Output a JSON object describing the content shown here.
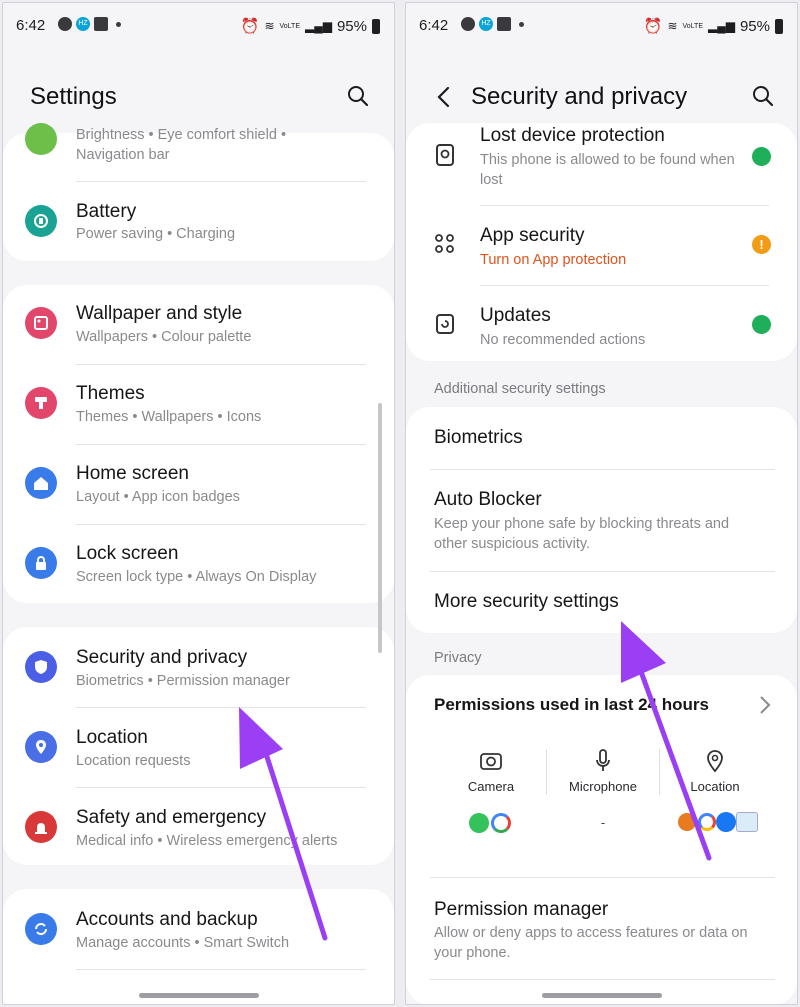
{
  "status": {
    "time": "6:42",
    "battery": "95%",
    "hz_badge": "HZ",
    "volte": "VoLTE"
  },
  "left": {
    "title": "Settings",
    "partial": {
      "sub_line1": "Brightness  •  Eye comfort shield  •",
      "sub_line2": "Navigation bar"
    },
    "items": [
      {
        "title": "Battery",
        "sub": "Power saving  •  Charging",
        "icon": "battery-icon",
        "color": "#1aa394"
      },
      {
        "title": "Wallpaper and style",
        "sub": "Wallpapers  •  Colour palette",
        "icon": "wallpaper-icon",
        "color": "#e2466b"
      },
      {
        "title": "Themes",
        "sub": "Themes  •  Wallpapers  •  Icons",
        "icon": "themes-icon",
        "color": "#e2466b"
      },
      {
        "title": "Home screen",
        "sub": "Layout  •  App icon badges",
        "icon": "home-icon",
        "color": "#3a7bea"
      },
      {
        "title": "Lock screen",
        "sub": "Screen lock type  •  Always On Display",
        "icon": "lock-icon",
        "color": "#3a7bea"
      },
      {
        "title": "Security and privacy",
        "sub": "Biometrics  •  Permission manager",
        "icon": "shield-icon",
        "color": "#4a5fe6"
      },
      {
        "title": "Location",
        "sub": "Location requests",
        "icon": "location-pin-icon",
        "color": "#4a6ee6"
      },
      {
        "title": "Safety and emergency",
        "sub": "Medical info  •  Wireless emergency alerts",
        "icon": "emergency-icon",
        "color": "#d93838"
      },
      {
        "title": "Accounts and backup",
        "sub": "Manage accounts  •  Smart Switch",
        "icon": "sync-icon",
        "color": "#3a7bea"
      }
    ]
  },
  "right": {
    "title": "Security and privacy",
    "lost": {
      "title": "Lost device protection",
      "sub": "This phone is allowed to be found when lost"
    },
    "app_security": {
      "title": "App security",
      "sub": "Turn on App protection",
      "sub_color": "#e0531c"
    },
    "updates": {
      "title": "Updates",
      "sub": "No recommended actions"
    },
    "additional_label": "Additional security settings",
    "biometrics": "Biometrics",
    "auto_blocker": {
      "title": "Auto Blocker",
      "sub": "Keep your phone safe by blocking threats and other suspicious activity."
    },
    "more_security": "More security settings",
    "privacy_label": "Privacy",
    "permissions_used": "Permissions used in last 24 hours",
    "columns": [
      {
        "label": "Camera",
        "icon": "camera-icon"
      },
      {
        "label": "Microphone",
        "icon": "microphone-icon",
        "value": "-"
      },
      {
        "label": "Location",
        "icon": "location-icon"
      }
    ],
    "permission_manager": {
      "title": "Permission manager",
      "sub": "Allow or deny apps to access features or data on your phone."
    }
  },
  "colors": {
    "arrow": "#9b3ff5",
    "check": "#1fae5a",
    "warning": "#f29b15"
  }
}
